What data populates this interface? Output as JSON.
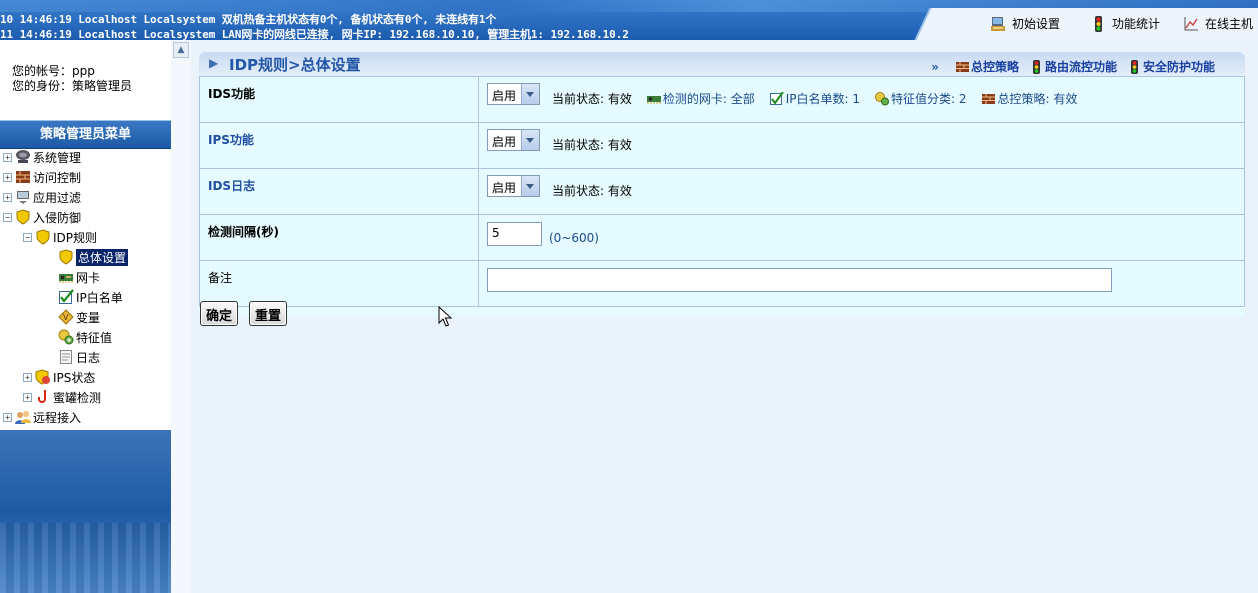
{
  "top": {
    "log_line1": "10 14:46:19 Localhost Localsystem 双机热备主机状态有0个, 备机状态有0个, 未连线有1个",
    "log_line2": "11 14:46:19 Localhost Localsystem LAN网卡的网线已连接, 网卡IP: 192.168.10.10, 管理主机1: 192.168.10.2",
    "tabs": [
      {
        "label": "初始设置",
        "icon": "setup-icon"
      },
      {
        "label": "功能统计",
        "icon": "traffic-light-icon"
      },
      {
        "label": "在线主机",
        "icon": "chart-icon"
      }
    ]
  },
  "sidebar": {
    "account_label": "您的帐号：ppp",
    "role_label": "您的身份：策略管理员",
    "menu_title": "策略管理员菜单",
    "items": [
      {
        "label": "系统管理",
        "icon": "computer-icon"
      },
      {
        "label": "访问控制",
        "icon": "firewall-icon"
      },
      {
        "label": "应用过滤",
        "icon": "filter-icon"
      },
      {
        "label": "入侵防御",
        "icon": "shield-icon"
      },
      {
        "label": "IDP规则",
        "icon": "shield-icon"
      },
      {
        "label": "总体设置",
        "icon": "shield-icon"
      },
      {
        "label": "网卡",
        "icon": "nic-icon"
      },
      {
        "label": "IP白名单",
        "icon": "checkbox-icon"
      },
      {
        "label": "变量",
        "icon": "variable-icon"
      },
      {
        "label": "特征值",
        "icon": "signature-icon"
      },
      {
        "label": "日志",
        "icon": "log-icon"
      },
      {
        "label": "IPS状态",
        "icon": "ips-status-icon"
      },
      {
        "label": "蜜罐检测",
        "icon": "honeypot-icon"
      },
      {
        "label": "远程接入",
        "icon": "users-icon"
      }
    ]
  },
  "main": {
    "breadcrumb": "IDP规则>总体设置",
    "links": {
      "raquo": "»",
      "total_policy": "总控策略",
      "route_flow": "路由流控功能",
      "security": "安全防护功能"
    },
    "rows": {
      "ids": {
        "label": "IDS功能",
        "select_value": "启用",
        "status": "当前状态: 有效",
        "nic": "检测的网卡: 全部",
        "whitelist": "IP白名单数: 1",
        "signature_class": "特征值分类: 2",
        "total_policy": "总控策略: 有效"
      },
      "ips": {
        "label": "IPS功能",
        "select_value": "启用",
        "status": "当前状态: 有效"
      },
      "ids_log": {
        "label": "IDS日志",
        "select_value": "启用",
        "status": "当前状态: 有效"
      },
      "interval": {
        "label": "检测间隔(秒)",
        "value": "5",
        "range": "(0~600)"
      },
      "remark": {
        "label": "备注",
        "value": ""
      }
    },
    "buttons": {
      "confirm": "确定",
      "reset": "重置"
    }
  },
  "colors": {
    "banner": "#1c5cb0",
    "menu_header": "#1d5aa6",
    "content_bg": "#e6fbff",
    "title_text": "#2456a8",
    "selected": "#0a246a"
  }
}
